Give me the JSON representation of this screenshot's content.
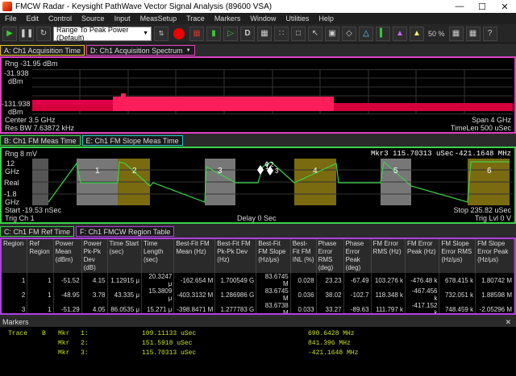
{
  "window": {
    "title": "FMCW Radar - Keysight PathWave Vector Signal Analysis (89600 VSA)"
  },
  "menu": [
    "File",
    "Edit",
    "Control",
    "Source",
    "Input",
    "MeasSetup",
    "Trace",
    "Markers",
    "Window",
    "Utilities",
    "Help"
  ],
  "toolbar": {
    "range_select": "Range To Peak Power (Default)",
    "zoom": "50 %"
  },
  "tabs_top": {
    "a": "A: Ch1 Acquisition Time",
    "d": "D: Ch1 Acquisition Spectrum"
  },
  "spectrum": {
    "rng": "Rng -31.95 dBm",
    "ytop": "-31.938",
    "ytop_unit": "dBm",
    "ybot": "-131.938",
    "ybot_unit": "dBm",
    "center": "Center 3.5 GHz",
    "resbw": "Res BW 7.63872 kHz",
    "span": "Span 4 GHz",
    "timelen": "TimeLen 500 uSec"
  },
  "tabs_mid": {
    "b": "B: Ch1 FM Meas Time",
    "e": "E: Ch1 FM Slope Meas Time"
  },
  "fm": {
    "rng": "Rng 8 mV",
    "marker_readout": "Mkr3   115.70313 uSec",
    "marker_val": "-421.1648 MHz",
    "y_top": "12",
    "y_top_unit": "GHz",
    "y_mid": "Real",
    "y_bot": "-1.8",
    "y_bot_unit": "GHz",
    "start": "Start -19.53 nSec",
    "trig": "Trig Ch 1",
    "delay": "Delay 0  Sec",
    "stop": "Stop 235.82 uSec",
    "triglvl": "Trig Lvl 0  V",
    "regions": [
      "1",
      "2",
      "3",
      "4",
      "5",
      "6"
    ],
    "marker_labels": [
      "1",
      "2",
      "3"
    ]
  },
  "tabs_bot": {
    "c": "C: Ch1 FM Ref Time",
    "f": "F: Ch1 FMCW Region Table"
  },
  "region_table": {
    "headers": [
      "Region",
      "Ref Region",
      "Power Mean (dBm)",
      "Power Pk-Pk Dev (dB)",
      "Time Start (sec)",
      "Time Length (sec)",
      "Best-Fit FM Mean (Hz)",
      "Best-Fit FM Pk-Pk Dev (Hz)",
      "Best-Fit FM Slope (Hz/μs)",
      "Best-Fit FM INL (%)",
      "Phase Error RMS (deg)",
      "Phase Error Peak (deg)",
      "FM Error RMS (Hz)",
      "FM Error Peak (Hz)",
      "FM Slope Error RMS (Hz/μs)",
      "FM Slope Error Peak (Hz/μs)"
    ],
    "rows": [
      [
        "1",
        "1",
        "-51.52",
        "4.15",
        "1.12915 μ",
        "20.3247 μ",
        "-162.654 M",
        "1.700549 G",
        "83.6745 M",
        "0.028",
        "23.23",
        "-67.49",
        "103.276 k",
        "-476.48 k",
        "678.415 k",
        "1.80742 M"
      ],
      [
        "2",
        "1",
        "-48.95",
        "3.78",
        "43.335 μ",
        "15.3809 μ",
        "-403.3132 M",
        "1.286986 G",
        "83.6745 M",
        "0.036",
        "38.02",
        "-102.7",
        "118.348 k",
        "-467.456 k",
        "732.051 k",
        "1.88598 M"
      ],
      [
        "3",
        "1",
        "-51.29",
        "4.05",
        "86.0535 μ",
        "15.271 μ",
        "-398.8471 M",
        "1.277783 G",
        "83.6738 M",
        "0.033",
        "33.27",
        "-89.63",
        "111.797 k",
        "-417.152 k",
        "748.459 k",
        "-2.05296 M"
      ],
      [
        "4",
        "1",
        "-49.49",
        "5.56",
        "128.821 μ",
        "20.4346 μ",
        "-169.6735 M",
        "1.709725 G",
        "83.6683 M",
        "0.033",
        "23.18",
        "-67.78",
        "111.633 k",
        "-399.04 k",
        "789.342 k",
        "2.50533 M"
      ],
      [
        "5",
        "1",
        "-51.29",
        "4.12",
        "171.252 μ",
        "15.161 μ",
        "-405.2291 M",
        "1.288771 G",
        "83.6734 M",
        "0.032",
        "33.77",
        "-96.81",
        "105.438 k",
        "-412.213 k",
        "731.286 k",
        "2.21632 M"
      ]
    ]
  },
  "markers_panel": {
    "title": "Markers",
    "trace_label": "Trace",
    "trace_id": "B",
    "rows": [
      {
        "name": "Mkr",
        "num": "1:",
        "x": "109.11133 uSec",
        "y": "690.6428 MHz"
      },
      {
        "name": "Mkr",
        "num": "2:",
        "x": "151.5918 uSec",
        "y": "841.396 MHz"
      },
      {
        "name": "Mkr",
        "num": "3:",
        "x": "115.70313 uSec",
        "y": "-421.1648 MHz"
      }
    ]
  }
}
